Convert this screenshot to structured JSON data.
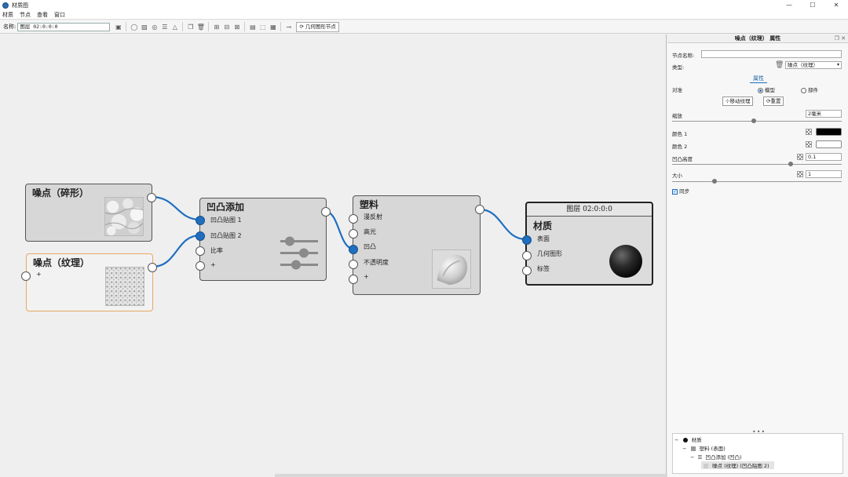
{
  "window": {
    "title": "材质图",
    "controls": [
      "—",
      "☐",
      "✕"
    ]
  },
  "menu": [
    "材质",
    "节点",
    "查看",
    "窗口"
  ],
  "toolbar": {
    "name_label": "名称:",
    "name_value": "图层 02:0:0:0",
    "geometry_button": "几何图形节点"
  },
  "nodes": {
    "noise_fractal": {
      "title": "噪点（碎形）"
    },
    "noise_texture": {
      "title": "噪点（纹理）",
      "input": "+"
    },
    "bump_add": {
      "title": "凹凸添加",
      "inputs": [
        "凹凸贴图 1",
        "凹凸贴图 2",
        "比率",
        "+"
      ]
    },
    "plastic": {
      "title": "塑料",
      "inputs": [
        "漫反射",
        "高光",
        "凹凸",
        "不透明度",
        "+"
      ]
    },
    "output": {
      "header": "图层 02:0:0:0",
      "title": "材质",
      "inputs": [
        "表面",
        "几何图形",
        "标签"
      ]
    }
  },
  "panel": {
    "title": "噪点（纹理） 属性",
    "node_name_label": "节点名称:",
    "node_name_value": "",
    "type_label": "类型:",
    "type_value": "噪点（纹理）",
    "tab": "属性",
    "align_label": "对准",
    "align_options": [
      "模型",
      "部件"
    ],
    "align_selected": "模型",
    "move_texture": "移动纹理",
    "reset": "重置",
    "scale_label": "缩放",
    "scale_value": "2毫米",
    "scale_level": 0.48,
    "color1_label": "颜色 1",
    "color1_value": "#000000",
    "color2_label": "颜色 2",
    "color2_value": "#ffffff",
    "bump_height_label": "凹凸高度",
    "bump_height_value": "0.1",
    "bump_height_level": 0.7,
    "size_label": "大小",
    "size_value": "1",
    "size_level": 0.25,
    "sync_label": "同步",
    "sync_checked": true
  },
  "tree": [
    {
      "label": "材质",
      "depth": 0
    },
    {
      "label": "塑料 (表面)",
      "depth": 1
    },
    {
      "label": "凹凸添加 (凹凸)",
      "depth": 2
    },
    {
      "label": "噪点 (纹理)   (凹凸贴图 2)",
      "depth": 3
    }
  ],
  "colors": {
    "accent": "#1f6fc1",
    "selected_border": "#e8a860",
    "node_bg": "#d7d7d7"
  }
}
